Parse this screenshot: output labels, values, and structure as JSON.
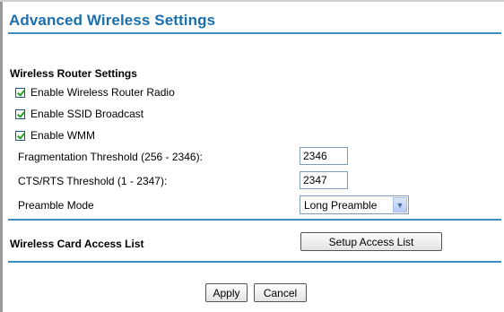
{
  "title": "Advanced Wireless Settings",
  "router_settings": {
    "heading": "Wireless Router Settings",
    "enable_radio": "Enable Wireless Router Radio",
    "enable_ssid": "Enable SSID Broadcast",
    "enable_wmm": "Enable WMM",
    "frag_label": "Fragmentation Threshold (256 - 2346):",
    "frag_value": "2346",
    "cts_label": "CTS/RTS Threshold (1 - 2347):",
    "cts_value": "2347",
    "preamble_label": "Preamble Mode",
    "preamble_value": "Long Preamble"
  },
  "access_list": {
    "label": "Wireless Card Access List",
    "button": "Setup Access List"
  },
  "buttons": {
    "apply": "Apply",
    "cancel": "Cancel"
  }
}
